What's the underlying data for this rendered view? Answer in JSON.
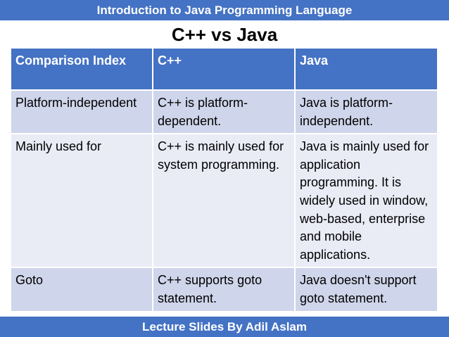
{
  "header": {
    "course_title": "Introduction to Java Programming Language"
  },
  "slide": {
    "title": "C++ vs Java"
  },
  "table": {
    "columns": [
      "Comparison Index",
      "C++",
      "Java"
    ],
    "rows": [
      [
        "Platform-independent",
        "C++ is platform-dependent.",
        "Java is platform-independent."
      ],
      [
        "Mainly used for",
        "C++ is mainly used for system programming.",
        "Java is mainly used for application programming. It is widely used in window, web-based, enterprise and mobile applications."
      ],
      [
        "Goto",
        "C++ supports goto statement.",
        "Java doesn't support goto statement."
      ]
    ]
  },
  "footer": {
    "text": "Lecture Slides By Adil Aslam"
  },
  "colors": {
    "accent": "#4472c4",
    "row_dark": "#cfd5ea",
    "row_light": "#e9ebf5"
  }
}
